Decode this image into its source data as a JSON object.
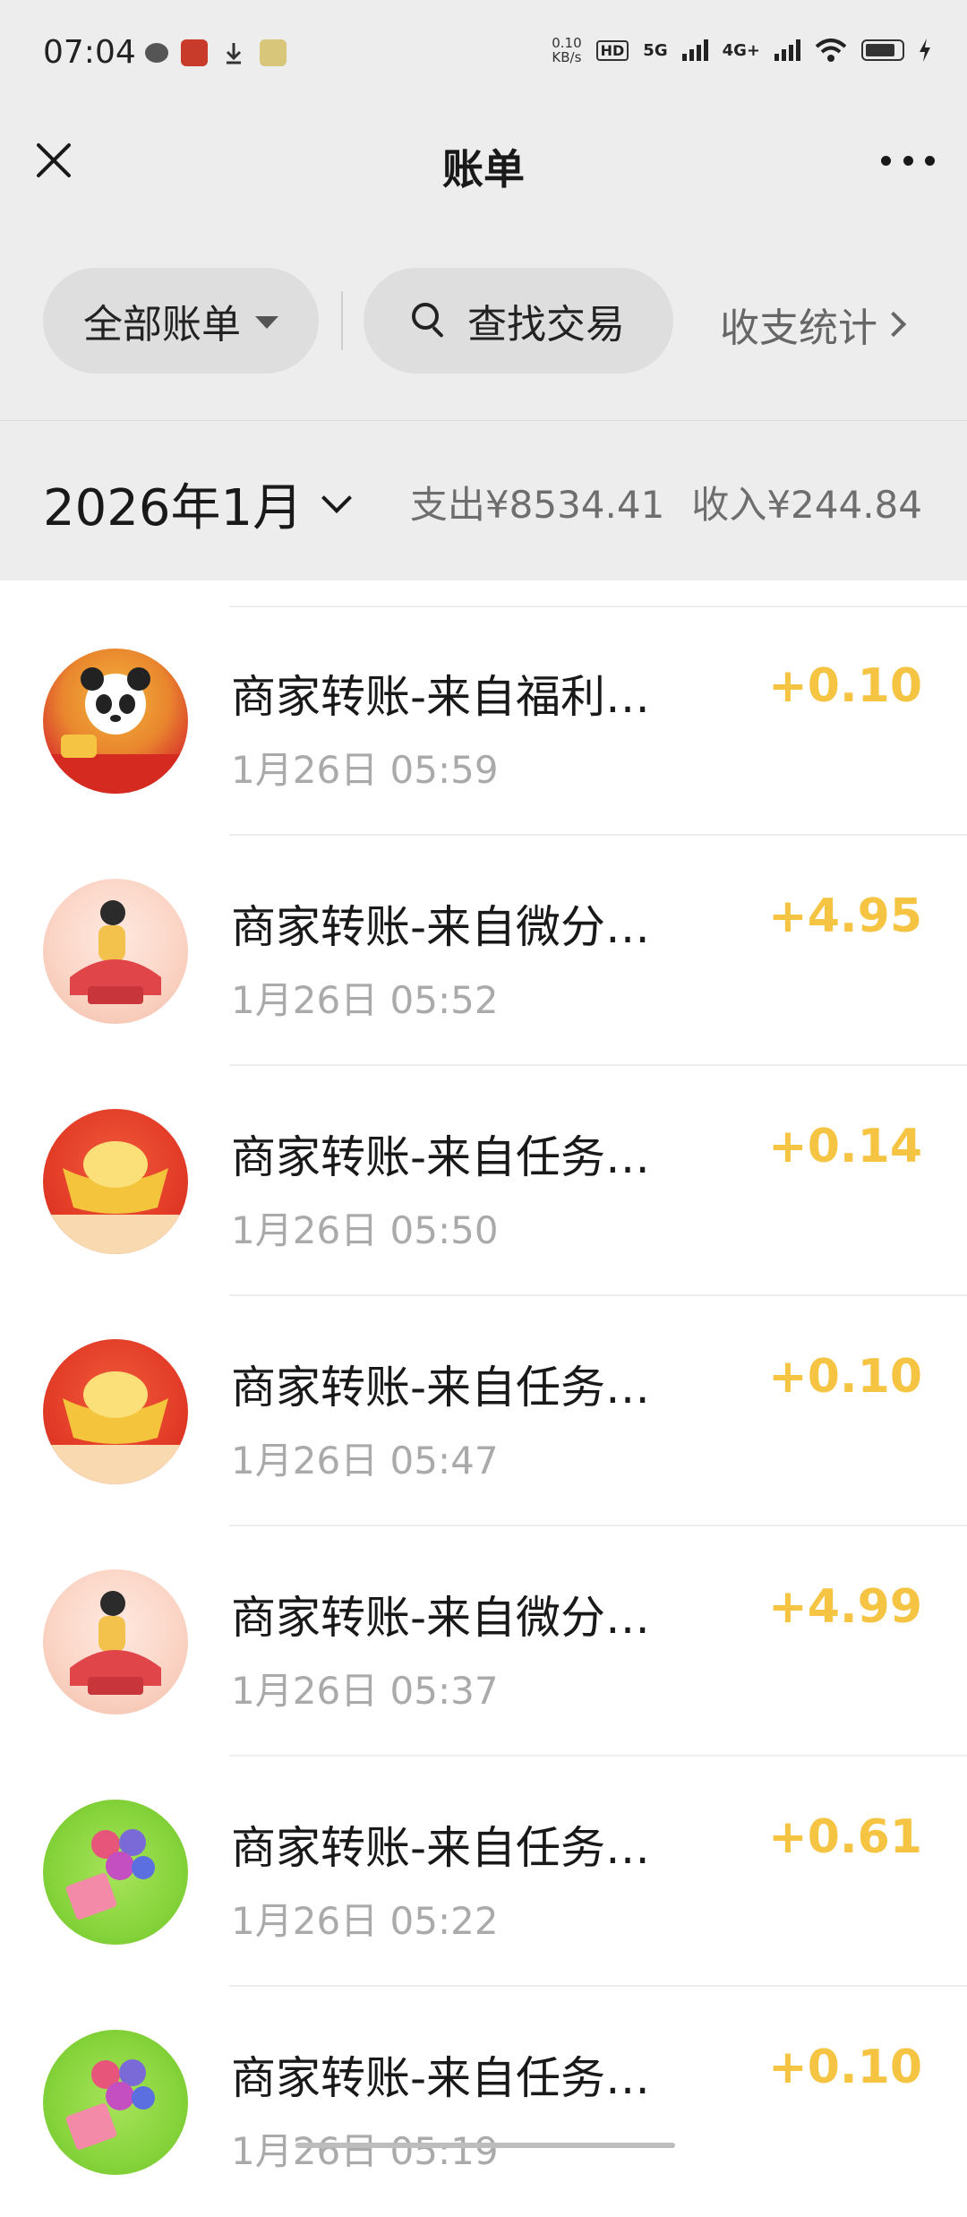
{
  "status_bar": {
    "time": "07:04",
    "net_speed_value": "0.10",
    "net_speed_unit": "KB/s",
    "hd_badge": "HD",
    "net_5g": "5G",
    "net_4g": "4G+"
  },
  "nav": {
    "title": "账单"
  },
  "filters": {
    "all_bills_label": "全部账单",
    "search_label": "查找交易",
    "stats_label": "收支统计"
  },
  "month_bar": {
    "month_label": "2026年1月",
    "expense_text": "支出¥8534.41",
    "income_text": "收入¥244.84"
  },
  "transactions": [
    {
      "title": "商家转账-来自福利…",
      "time": "1月26日 05:59",
      "amount": "+0.10",
      "avatar_icon": "panda-avatar"
    },
    {
      "title": "商家转账-来自微分…",
      "time": "1月26日 05:52",
      "amount": "+4.95",
      "avatar_icon": "girl-avatar"
    },
    {
      "title": "商家转账-来自任务…",
      "time": "1月26日 05:50",
      "amount": "+0.14",
      "avatar_icon": "gold-ingot-avatar"
    },
    {
      "title": "商家转账-来自任务…",
      "time": "1月26日 05:47",
      "amount": "+0.10",
      "avatar_icon": "gold-ingot-avatar"
    },
    {
      "title": "商家转账-来自微分…",
      "time": "1月26日 05:37",
      "amount": "+4.99",
      "avatar_icon": "girl-avatar"
    },
    {
      "title": "商家转账-来自任务…",
      "time": "1月26日 05:22",
      "amount": "+0.61",
      "avatar_icon": "flower-avatar"
    },
    {
      "title": "商家转账-来自任务…",
      "time": "1月26日 05:19",
      "amount": "+0.10",
      "avatar_icon": "flower-avatar"
    }
  ],
  "colors": {
    "income_amount": "#f6c443",
    "header_bg": "#ededed"
  }
}
